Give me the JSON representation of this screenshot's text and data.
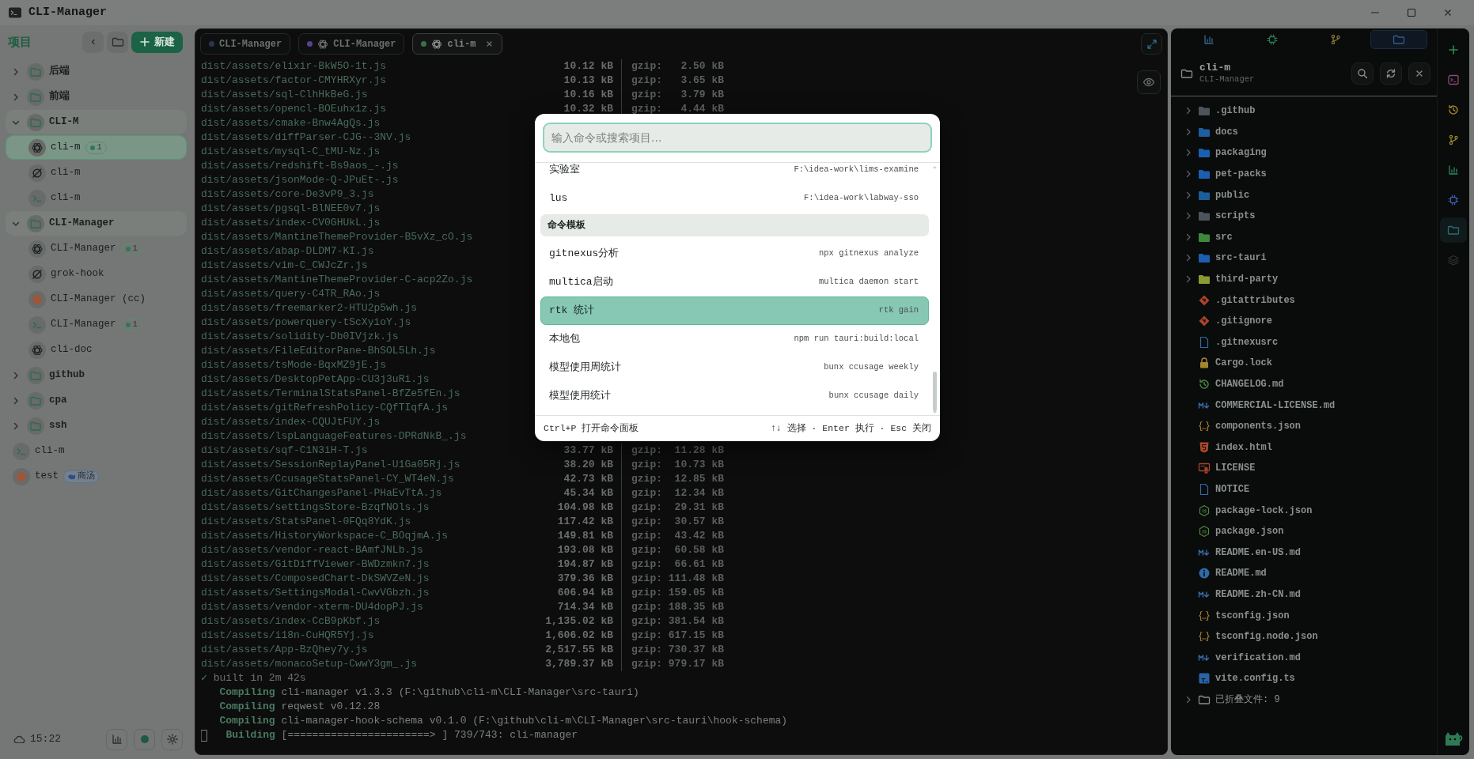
{
  "window": {
    "title": "CLI-Manager"
  },
  "sidebar": {
    "title": "项目",
    "new_button": "新建",
    "tree": [
      {
        "kind": "folder",
        "label": "后端",
        "expanded": false
      },
      {
        "kind": "folder",
        "label": "前端",
        "expanded": false
      },
      {
        "kind": "folder",
        "label": "CLI-M",
        "expanded": true,
        "children": [
          {
            "kind": "knot",
            "label": "cli-m",
            "badge": "1",
            "selected": true
          },
          {
            "kind": "ring",
            "label": "cli-m",
            "selected": false
          },
          {
            "kind": "shell",
            "label": "cli-m",
            "selected": false
          }
        ]
      },
      {
        "kind": "folder",
        "label": "CLI-Manager",
        "expanded": true,
        "children": [
          {
            "kind": "knot",
            "label": "CLI-Manager",
            "badge": "1",
            "selected": false
          },
          {
            "kind": "ring",
            "label": "grok-hook",
            "selected": false
          },
          {
            "kind": "spark",
            "label": "CLI-Manager (cc)",
            "selected": false
          },
          {
            "kind": "shell",
            "label": "CLI-Manager",
            "badge": "1",
            "selected": false
          },
          {
            "kind": "knot",
            "label": "cli-doc",
            "selected": false
          }
        ]
      },
      {
        "kind": "folder",
        "label": "github",
        "expanded": false
      },
      {
        "kind": "folder",
        "label": "cpa",
        "expanded": false
      },
      {
        "kind": "folder",
        "label": "ssh",
        "expanded": false
      },
      {
        "kind": "shell",
        "label": "cli-m",
        "selected": false
      },
      {
        "kind": "spark",
        "label": "test",
        "tag": "商汤",
        "selected": false
      }
    ],
    "time": "15:22"
  },
  "terminal": {
    "tabs": [
      {
        "kind": "plain",
        "label": "CLI-Manager",
        "color": "#2e3450",
        "selected": false
      },
      {
        "kind": "agent",
        "label": "CLI-Manager",
        "color": "#5b3f92",
        "selected": false
      },
      {
        "kind": "agent",
        "label": "cli-m",
        "color": "#3c6e4a",
        "selected": true
      }
    ],
    "lines": [
      {
        "kind": "asset",
        "name": "dist/assets/elixir-BkW5O-1t.js",
        "size": "10.12 kB",
        "gzip": "gzip:   2.50 kB"
      },
      {
        "kind": "asset",
        "name": "dist/assets/factor-CMYHRXyr.js",
        "size": "10.13 kB",
        "gzip": "gzip:   3.65 kB"
      },
      {
        "kind": "asset",
        "name": "dist/assets/sql-ClhHkBeG.js",
        "size": "10.16 kB",
        "gzip": "gzip:   3.79 kB"
      },
      {
        "kind": "asset",
        "name": "dist/assets/opencl-BOEuhx1z.js",
        "size": "10.32 kB",
        "gzip": "gzip:   4.44 kB"
      },
      {
        "kind": "asset",
        "name": "dist/assets/cmake-Bnw4AgQs.js"
      },
      {
        "kind": "asset",
        "name": "dist/assets/diffParser-CJG--3NV.js"
      },
      {
        "kind": "asset",
        "name": "dist/assets/mysql-C_tMU-Nz.js"
      },
      {
        "kind": "asset",
        "name": "dist/assets/redshift-Bs9aos_-.js"
      },
      {
        "kind": "asset",
        "name": "dist/assets/jsonMode-Q-JPuEt-.js"
      },
      {
        "kind": "asset",
        "name": "dist/assets/core-De3vP9_3.js"
      },
      {
        "kind": "asset",
        "name": "dist/assets/pgsql-BlNEE0v7.js"
      },
      {
        "kind": "asset",
        "name": "dist/assets/index-CV0GHUkL.js"
      },
      {
        "kind": "asset",
        "name": "dist/assets/MantineThemeProvider-B5vXz_cO.js"
      },
      {
        "kind": "asset",
        "name": "dist/assets/abap-DLDM7-KI.js"
      },
      {
        "kind": "asset",
        "name": "dist/assets/vim-C_CWJcZr.js"
      },
      {
        "kind": "asset",
        "name": "dist/assets/MantineThemeProvider-C-acp2Zo.js"
      },
      {
        "kind": "asset",
        "name": "dist/assets/query-C4TR_RAo.js"
      },
      {
        "kind": "asset",
        "name": "dist/assets/freemarker2-HTU2p5wh.js"
      },
      {
        "kind": "asset",
        "name": "dist/assets/powerquery-tScXyioY.js"
      },
      {
        "kind": "asset",
        "name": "dist/assets/solidity-Db0IVjzk.js"
      },
      {
        "kind": "asset",
        "name": "dist/assets/FileEditorPane-BhSOL5Lh.js"
      },
      {
        "kind": "asset",
        "name": "dist/assets/tsMode-BqxMZ9jE.js"
      },
      {
        "kind": "asset",
        "name": "dist/assets/DesktopPetApp-CU3j3uRi.js"
      },
      {
        "kind": "asset",
        "name": "dist/assets/TerminalStatsPanel-BfZe5fEn.js"
      },
      {
        "kind": "asset",
        "name": "dist/assets/gitRefreshPolicy-CQfTIqfA.js"
      },
      {
        "kind": "asset",
        "name": "dist/assets/index-CQUJtFUY.js"
      },
      {
        "kind": "asset",
        "name": "dist/assets/lspLanguageFeatures-DPRdNkB_.js"
      },
      {
        "kind": "asset",
        "name": "dist/assets/sqf-C1N3iH-T.js",
        "size": "33.77 kB",
        "gzip": "gzip:  11.28 kB"
      },
      {
        "kind": "asset",
        "name": "dist/assets/SessionReplayPanel-U1Ga05Rj.js",
        "size": "38.20 kB",
        "gzip": "gzip:  10.73 kB"
      },
      {
        "kind": "asset",
        "name": "dist/assets/CcusageStatsPanel-CY_WT4eN.js",
        "size": "42.73 kB",
        "gzip": "gzip:  12.85 kB"
      },
      {
        "kind": "asset",
        "name": "dist/assets/GitChangesPanel-PHaEvTtA.js",
        "size": "45.34 kB",
        "gzip": "gzip:  12.34 kB"
      },
      {
        "kind": "asset",
        "name": "dist/assets/settingsStore-BzqfNOls.js",
        "size": "104.98 kB",
        "gzip": "gzip:  29.31 kB"
      },
      {
        "kind": "asset",
        "name": "dist/assets/StatsPanel-0FQq8YdK.js",
        "size": "117.42 kB",
        "gzip": "gzip:  30.57 kB"
      },
      {
        "kind": "asset",
        "name": "dist/assets/HistoryWorkspace-C_BOqjmA.js",
        "size": "149.81 kB",
        "gzip": "gzip:  43.42 kB"
      },
      {
        "kind": "asset",
        "name": "dist/assets/vendor-react-BAmfJNLb.js",
        "size": "193.08 kB",
        "gzip": "gzip:  60.58 kB"
      },
      {
        "kind": "asset",
        "name": "dist/assets/GitDiffViewer-BWDzmkn7.js",
        "size": "194.87 kB",
        "gzip": "gzip:  66.61 kB"
      },
      {
        "kind": "asset",
        "name": "dist/assets/ComposedChart-DkSWVZeN.js",
        "size": "379.36 kB",
        "gzip": "gzip: 111.48 kB"
      },
      {
        "kind": "asset",
        "name": "dist/assets/SettingsModal-CwvVGbzh.js",
        "size": "606.94 kB",
        "gzip": "gzip: 159.05 kB"
      },
      {
        "kind": "asset",
        "name": "dist/assets/vendor-xterm-DU4dopPJ.js",
        "size": "714.34 kB",
        "gzip": "gzip: 188.35 kB"
      },
      {
        "kind": "asset",
        "name": "dist/assets/index-CcB9pKbf.js",
        "size": "1,135.02 kB",
        "gzip": "gzip: 381.54 kB"
      },
      {
        "kind": "asset",
        "name": "dist/assets/i18n-CuHQR5Yj.js",
        "size": "1,606.02 kB",
        "gzip": "gzip: 617.15 kB"
      },
      {
        "kind": "asset",
        "name": "dist/assets/App-BzQhey7y.js",
        "size": "2,517.55 kB",
        "gzip": "gzip: 730.37 kB"
      },
      {
        "kind": "asset",
        "name": "dist/assets/monacoSetup-CwwY3gm_.js",
        "size": "3,789.37 kB",
        "gzip": "gzip: 979.17 kB"
      },
      {
        "kind": "done",
        "mark": "✓",
        "text": "built in 2m 42s"
      },
      {
        "kind": "cargo",
        "verb": "Compiling",
        "text": "cli-manager v1.3.3 (F:\\github\\cli-m\\CLI-Manager\\src-tauri)"
      },
      {
        "kind": "cargo",
        "verb": "Compiling",
        "text": "reqwest v0.12.28"
      },
      {
        "kind": "cargo",
        "verb": "Compiling",
        "text": "cli-manager-hook-schema v0.1.0 (F:\\github\\cli-m\\CLI-Manager\\src-tauri\\hook-schema)"
      },
      {
        "kind": "progress",
        "verb": "Building",
        "text": "[=======================> ] 739/743: cli-manager"
      }
    ]
  },
  "palette": {
    "placeholder": "输入命令或搜索项目...",
    "items": [
      {
        "kind": "item",
        "label": "实验室",
        "detail": "F:\\idea-work\\lims-examine",
        "selected": false
      },
      {
        "kind": "item",
        "label": "lus",
        "detail": "F:\\idea-work\\labway-sso",
        "selected": false
      },
      {
        "kind": "header",
        "label": "命令模板"
      },
      {
        "kind": "item",
        "label": "gitnexus分析",
        "detail": "npx gitnexus analyze",
        "selected": false
      },
      {
        "kind": "item",
        "label": "multica启动",
        "detail": "multica daemon start",
        "selected": false
      },
      {
        "kind": "item",
        "label": "rtk 统计",
        "detail": "rtk gain",
        "selected": true
      },
      {
        "kind": "item",
        "label": "本地包",
        "detail": "npm run tauri:build:local",
        "selected": false
      },
      {
        "kind": "item",
        "label": "模型使用周统计",
        "detail": "bunx ccusage weekly",
        "selected": false
      },
      {
        "kind": "item",
        "label": "模型使用统计",
        "detail": "bunx ccusage daily",
        "selected": false
      }
    ],
    "footer_left": "Ctrl+P 打开命令面板",
    "footer_right": "↑↓ 选择 · Enter 执行 · Esc 关闭"
  },
  "file_panel": {
    "view_tabs": [
      {
        "kind": "chart",
        "selected": false
      },
      {
        "kind": "chip",
        "selected": false
      },
      {
        "kind": "branch",
        "selected": false
      },
      {
        "kind": "folder",
        "selected": true
      }
    ],
    "name": "cli-m",
    "path": "CLI-Manager",
    "files": [
      {
        "kind": "folder",
        "name": ".github",
        "color": "#4d545b"
      },
      {
        "kind": "folder",
        "name": "docs",
        "color": "#1e5fa0"
      },
      {
        "kind": "folder",
        "name": "packaging",
        "color": "#1b60b0"
      },
      {
        "kind": "folder",
        "name": "pet-packs",
        "color": "#1b60b0"
      },
      {
        "kind": "folder",
        "name": "public",
        "color": "#1a5f9a"
      },
      {
        "kind": "folder",
        "name": "scripts",
        "color": "#4d545b"
      },
      {
        "kind": "folder",
        "name": "src",
        "color": "#3b8a3b"
      },
      {
        "kind": "folder",
        "name": "src-tauri",
        "color": "#1b60b0"
      },
      {
        "kind": "folder",
        "name": "third-party",
        "color": "#8c9a33"
      },
      {
        "kind": "git",
        "name": ".gitattributes"
      },
      {
        "kind": "git",
        "name": ".gitignore"
      },
      {
        "kind": "doc",
        "name": ".gitnexusrc"
      },
      {
        "kind": "lock",
        "name": "Cargo.lock"
      },
      {
        "kind": "history",
        "name": "CHANGELOG.md"
      },
      {
        "kind": "markdown",
        "name": "COMMERCIAL-LICENSE.md"
      },
      {
        "kind": "braces",
        "name": "components.json"
      },
      {
        "kind": "html",
        "name": "index.html"
      },
      {
        "kind": "license",
        "name": "LICENSE"
      },
      {
        "kind": "doc",
        "name": "NOTICE"
      },
      {
        "kind": "node",
        "name": "package-lock.json"
      },
      {
        "kind": "node",
        "name": "package.json"
      },
      {
        "kind": "markdown",
        "name": "README.en-US.md"
      },
      {
        "kind": "info",
        "name": "README.md"
      },
      {
        "kind": "markdown",
        "name": "README.zh-CN.md"
      },
      {
        "kind": "braces",
        "name": "tsconfig.json"
      },
      {
        "kind": "braces",
        "name": "tsconfig.node.json"
      },
      {
        "kind": "markdown",
        "name": "verification.md"
      },
      {
        "kind": "ts",
        "name": "vite.config.ts"
      }
    ],
    "collapsed": "已折叠文件: 9"
  },
  "activity": [
    {
      "kind": "plus",
      "selected": false
    },
    {
      "kind": "terminal",
      "selected": false
    },
    {
      "kind": "history",
      "selected": false
    },
    {
      "kind": "branch",
      "selected": false
    },
    {
      "kind": "chart",
      "selected": false
    },
    {
      "kind": "chip",
      "selected": false
    },
    {
      "kind": "folder",
      "selected": true
    },
    {
      "kind": "layers",
      "selected": false
    }
  ]
}
